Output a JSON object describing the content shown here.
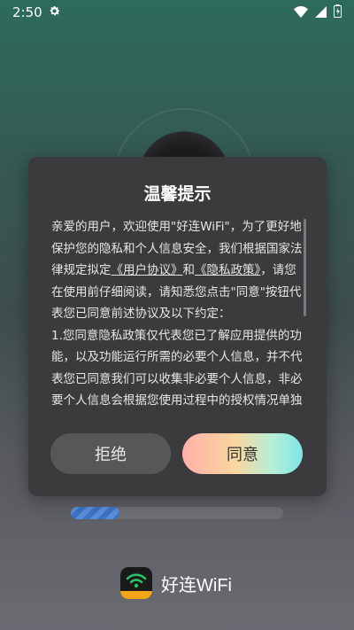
{
  "status_bar": {
    "time": "2:50"
  },
  "dialog": {
    "title": "温馨提示",
    "text_before_links": "亲爱的用户，欢迎使用\"好连WiFi\"，为了更好地保护您的隐私和个人信息安全，我们根据国家法律规定拟定",
    "link_user_agreement": "《用户协议》",
    "and": "和",
    "link_privacy_policy": "《隐私政策》",
    "text_after_links": "，请您在使用前仔细阅读，请知悉您点击\"同意\"按钮代表您已同意前述协议及以下约定：",
    "item_1": "1.您同意隐私政策仅代表您已了解应用提供的功能，以及功能运行所需的必要个人信息，并不代表您已同意我们可以收集非必要个人信息，非必要个人信息会根据您使用过程中的授权情况单独征求您的同意。",
    "reject_label": "拒绝",
    "accept_label": "同意"
  },
  "progress": {
    "value": 0.23
  },
  "brand": {
    "name": "好连WiFi",
    "logo_tag": "好连WiFi"
  },
  "colors": {
    "accent_gradient": [
      "#ffb1a8",
      "#7fe6e6"
    ],
    "dialog_bg": "#3b3b3d"
  }
}
